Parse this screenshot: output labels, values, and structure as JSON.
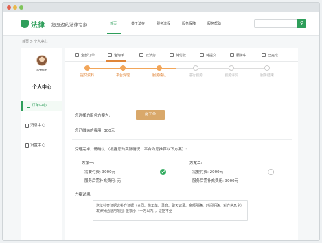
{
  "nav": {
    "logo_name": "法律",
    "slogan": "您身边的法律专家",
    "items": [
      "首页",
      "关于法在",
      "服务流程",
      "服务保障",
      "服务帮助"
    ],
    "search_placeholder": ""
  },
  "breadcrumb": "首页  >  个人中心",
  "sidebar": {
    "username": "admin",
    "title": "个人中心",
    "items": [
      {
        "label": "订单中心",
        "active": true
      },
      {
        "label": "消息中心",
        "active": false
      },
      {
        "label": "设置中心",
        "active": false
      }
    ]
  },
  "tabs": [
    {
      "label": "全部订单",
      "active": false
    },
    {
      "label": "咨询单",
      "active": true
    },
    {
      "label": "云法务",
      "active": false
    },
    {
      "label": "待付款",
      "active": false
    },
    {
      "label": "待提交",
      "active": false
    },
    {
      "label": "服务中",
      "active": false
    },
    {
      "label": "已完成",
      "active": false
    }
  ],
  "steps": [
    {
      "label": "提交资料",
      "done": true
    },
    {
      "label": "平台受理",
      "done": true
    },
    {
      "label": "服务确认",
      "done": true
    },
    {
      "label": "进行服务",
      "done": false
    },
    {
      "label": "服务评价",
      "done": false
    },
    {
      "label": "服务结束",
      "done": false
    }
  ],
  "order": {
    "chosen_label": "您选择的服务方案为:",
    "order_button": "施工单",
    "fee_text": "您已缴纳的费用:  300元",
    "change_notice": "受理完毕，请确认 （根据您的实际情况，平台为您推荐以下方案）:"
  },
  "plans": [
    {
      "name": "方案一:",
      "required_fee": "需要付费:  3000元",
      "followup_fee": "服务后需补充费用:  无",
      "selected": true
    },
    {
      "name": "方案二:",
      "required_fee": "需要付费:  2000元",
      "followup_fee": "服务后需补充费用:  3000元",
      "selected": false
    }
  ],
  "description": {
    "label": "方案说明:",
    "text": "这法补齐证据这补齐证据（合同、施工单、录音、聊天记录、金额明确、时间明确、对方信息全）发律师函适用范围: 金额小（一万以内），证据不全"
  },
  "colors": {
    "brand_green": "#2e9e5a",
    "accent_orange": "#e0863a",
    "button_tan": "#d9a86a"
  }
}
